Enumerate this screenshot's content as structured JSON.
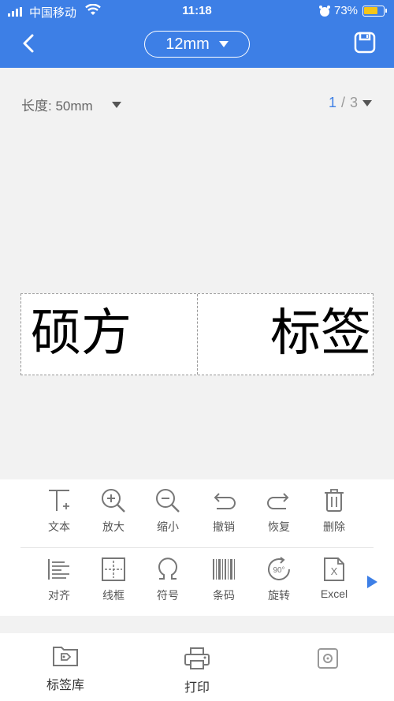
{
  "status_bar": {
    "carrier": "中国移动",
    "time": "11:18",
    "battery": "73%",
    "battery_level": 0.73
  },
  "header": {
    "tape_size": "12mm",
    "icons": [
      "back-chevron-icon",
      "save-icon"
    ]
  },
  "label_info": {
    "length": "长度: 50mm",
    "page_current": "1",
    "page_separator": "/",
    "page_total": "3"
  },
  "label": {
    "text_left": "硕方",
    "text_right": "标签"
  },
  "toolbar": {
    "row1": [
      {
        "label": "文本",
        "icon": "text-icon"
      },
      {
        "label": "放大",
        "icon": "zoom-in-icon"
      },
      {
        "label": "缩小",
        "icon": "zoom-out-icon"
      },
      {
        "label": "撤销",
        "icon": "undo-icon"
      },
      {
        "label": "恢复",
        "icon": "redo-icon"
      },
      {
        "label": "删除",
        "icon": "delete-icon"
      }
    ],
    "row2": [
      {
        "label": "对齐",
        "icon": "align-icon"
      },
      {
        "label": "线框",
        "icon": "frame-icon"
      },
      {
        "label": "符号",
        "icon": "symbol-icon"
      },
      {
        "label": "条码",
        "icon": "barcode-icon"
      },
      {
        "label": "旋转",
        "icon": "rotate-icon"
      },
      {
        "label": "Excel",
        "icon": "excel-icon"
      }
    ],
    "rotate_badge": "90°",
    "excel_badge": "X"
  },
  "bottom_nav": [
    {
      "label": "标签库",
      "icon": "label-library-icon"
    },
    {
      "label": "打印",
      "icon": "printer-icon"
    },
    {
      "label": "",
      "icon": "settings-icon"
    }
  ],
  "colors": {
    "accent": "#3d7fe6",
    "background": "#f2f2f2"
  }
}
